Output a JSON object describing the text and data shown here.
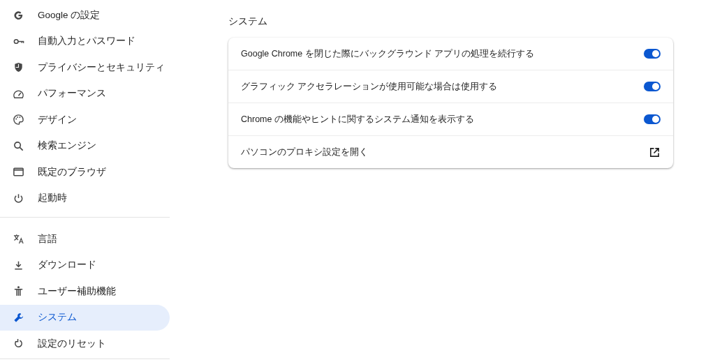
{
  "sidebar": {
    "groups": [
      {
        "items": [
          {
            "label": "Google の設定",
            "selected": false
          },
          {
            "label": "自動入力とパスワード",
            "selected": false
          },
          {
            "label": "プライバシーとセキュリティ",
            "selected": false
          },
          {
            "label": "パフォーマンス",
            "selected": false
          },
          {
            "label": "デザイン",
            "selected": false
          },
          {
            "label": "検索エンジン",
            "selected": false
          },
          {
            "label": "既定のブラウザ",
            "selected": false
          },
          {
            "label": "起動時",
            "selected": false
          }
        ]
      },
      {
        "items": [
          {
            "label": "言語",
            "selected": false
          },
          {
            "label": "ダウンロード",
            "selected": false
          },
          {
            "label": "ユーザー補助機能",
            "selected": false
          },
          {
            "label": "システム",
            "selected": true
          },
          {
            "label": "設定のリセット",
            "selected": false
          }
        ]
      }
    ]
  },
  "section": {
    "title": "システム",
    "rows": [
      {
        "kind": "toggle",
        "label": "Google Chrome を閉じた際にバックグラウンド アプリの処理を続行する",
        "on": true
      },
      {
        "kind": "toggle",
        "label": "グラフィック アクセラレーションが使用可能な場合は使用する",
        "on": true
      },
      {
        "kind": "toggle",
        "label": "Chrome の機能やヒントに関するシステム通知を表示する",
        "on": true
      },
      {
        "kind": "link",
        "label": "パソコンのプロキシ設定を開く"
      }
    ]
  }
}
